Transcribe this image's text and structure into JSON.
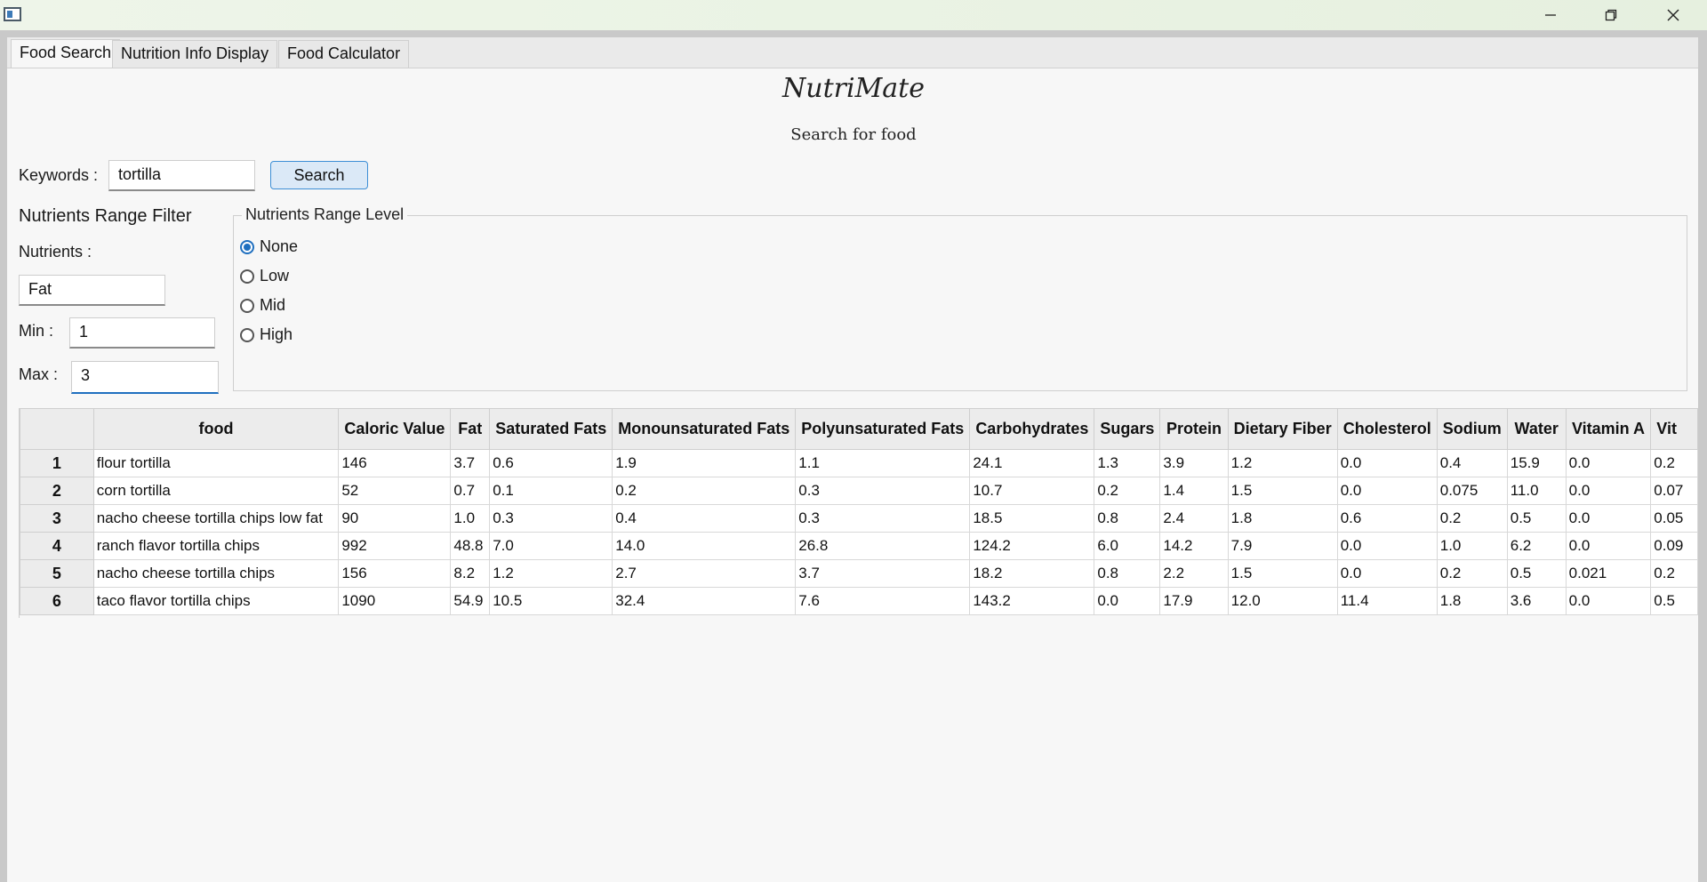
{
  "window": {
    "minimize_icon": "minimize-icon",
    "maximize_icon": "restore-icon",
    "close_icon": "close-icon"
  },
  "tabs": [
    {
      "label": "Food Search",
      "active": true
    },
    {
      "label": "Nutrition Info Display",
      "active": false
    },
    {
      "label": "Food Calculator",
      "active": false
    }
  ],
  "header": {
    "title": "NutriMate",
    "subtitle": "Search for food"
  },
  "search": {
    "keywords_label": "Keywords :",
    "keywords_value": "tortilla",
    "button_label": "Search"
  },
  "filter": {
    "title": "Nutrients Range Filter",
    "nutrients_label": "Nutrients :",
    "nutrient_value": "Fat",
    "min_label": "Min :",
    "min_value": "1",
    "max_label": "Max :",
    "max_value": "3"
  },
  "range_level": {
    "title": "Nutrients Range Level",
    "options": [
      {
        "label": "None",
        "checked": true
      },
      {
        "label": "Low",
        "checked": false
      },
      {
        "label": "Mid",
        "checked": false
      },
      {
        "label": "High",
        "checked": false
      }
    ]
  },
  "table": {
    "columns": [
      "food",
      "Caloric Value",
      "Fat",
      "Saturated Fats",
      "Monounsaturated Fats",
      "Polyunsaturated Fats",
      "Carbohydrates",
      "Sugars",
      "Protein",
      "Dietary Fiber",
      "Cholesterol",
      "Sodium",
      "Water",
      "Vitamin A",
      "Vit"
    ],
    "rows": [
      {
        "index": "1",
        "cells": [
          "flour tortilla",
          "146",
          "3.7",
          "0.6",
          "1.9",
          "1.1",
          "24.1",
          "1.3",
          "3.9",
          "1.2",
          "0.0",
          "0.4",
          "15.9",
          "0.0",
          "0.2"
        ]
      },
      {
        "index": "2",
        "cells": [
          "corn tortilla",
          "52",
          "0.7",
          "0.1",
          "0.2",
          "0.3",
          "10.7",
          "0.2",
          "1.4",
          "1.5",
          "0.0",
          "0.075",
          "11.0",
          "0.0",
          "0.07"
        ]
      },
      {
        "index": "3",
        "cells": [
          "nacho cheese tortilla chips low fat",
          "90",
          "1.0",
          "0.3",
          "0.4",
          "0.3",
          "18.5",
          "0.8",
          "2.4",
          "1.8",
          "0.6",
          "0.2",
          "0.5",
          "0.0",
          "0.05"
        ]
      },
      {
        "index": "4",
        "cells": [
          "ranch flavor tortilla chips",
          "992",
          "48.8",
          "7.0",
          "14.0",
          "26.8",
          "124.2",
          "6.0",
          "14.2",
          "7.9",
          "0.0",
          "1.0",
          "6.2",
          "0.0",
          "0.09"
        ]
      },
      {
        "index": "5",
        "cells": [
          "nacho cheese tortilla chips",
          "156",
          "8.2",
          "1.2",
          "2.7",
          "3.7",
          "18.2",
          "0.8",
          "2.2",
          "1.5",
          "0.0",
          "0.2",
          "0.5",
          "0.021",
          "0.2"
        ]
      },
      {
        "index": "6",
        "cells": [
          "taco flavor tortilla chips",
          "1090",
          "54.9",
          "10.5",
          "32.4",
          "7.6",
          "143.2",
          "0.0",
          "17.9",
          "12.0",
          "11.4",
          "1.8",
          "3.6",
          "0.0",
          "0.5"
        ]
      }
    ]
  }
}
